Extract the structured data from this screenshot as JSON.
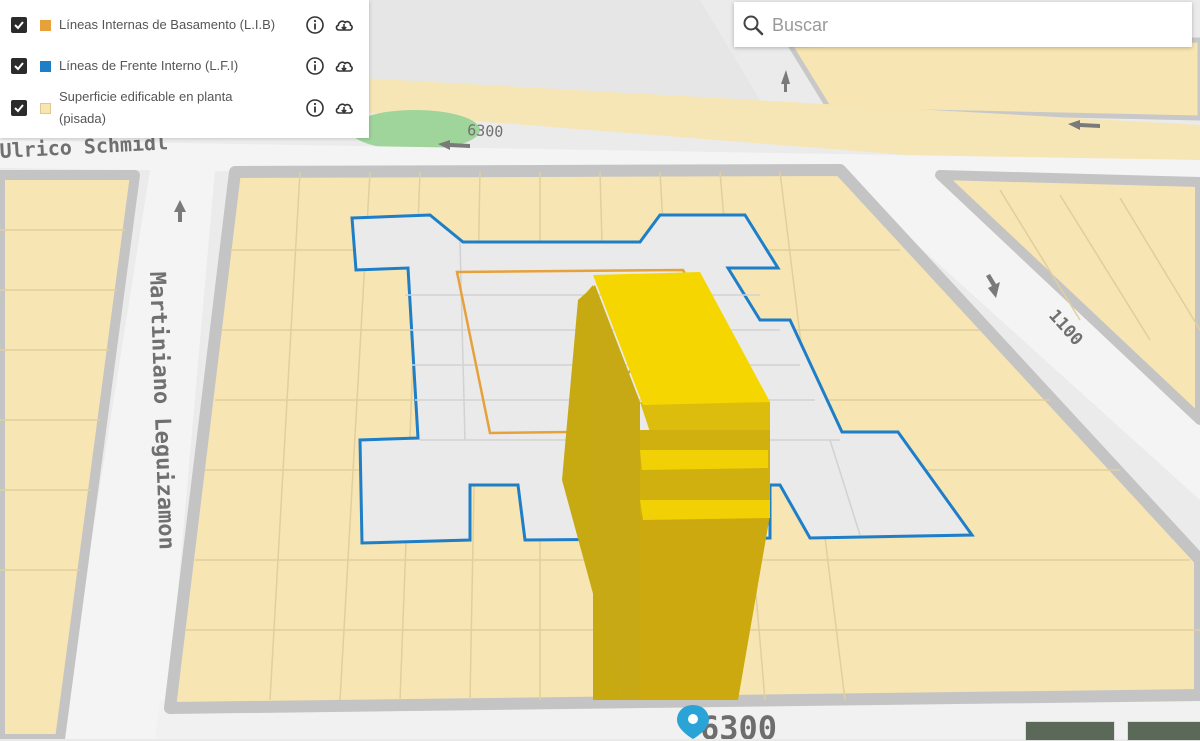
{
  "layers": [
    {
      "label": "Líneas Internas de Basamento (L.I.B)",
      "color": "#e6a13a",
      "checked": true
    },
    {
      "label": "Líneas de Frente Interno (L.F.I)",
      "color": "#1e7ec8",
      "checked": true
    },
    {
      "label": "Superficie edificable en planta (pisada)",
      "color": "#f7e6b0",
      "checked": true
    }
  ],
  "search": {
    "placeholder": "Buscar"
  },
  "map": {
    "streets": {
      "upper_left": "Ulrico Schmidl",
      "left_vertical": "Martiniano Leguizamon"
    },
    "address_numbers": {
      "top_center": "6300",
      "right_road": "1100",
      "bottom": "6300"
    },
    "colors": {
      "lot": "#f7e6b3",
      "road": "#f4f4f4",
      "curb": "#bdbdbd",
      "building": "#f2d000",
      "lfi_line": "#1e7ec8",
      "lib_line": "#e6a13a",
      "marker": "#2aa3d6"
    }
  }
}
